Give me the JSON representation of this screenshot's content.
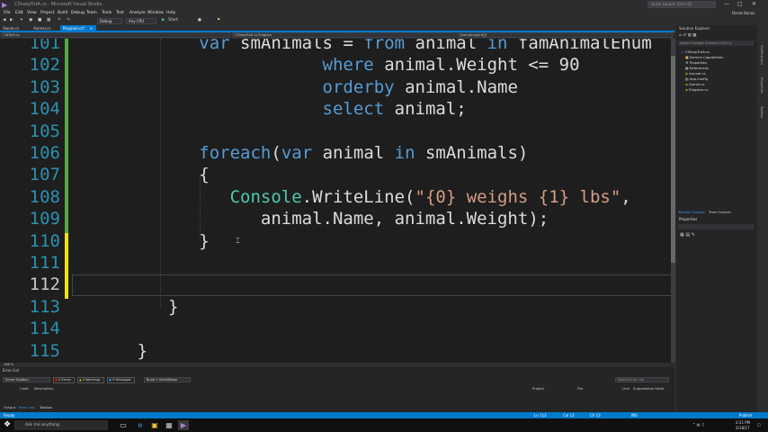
{
  "window": {
    "title": "CSharpTutA.cs - Microsoft Visual Studio",
    "quick_launch_placeholder": "Quick Launch (Ctrl+Q)",
    "user": "Derek Banas"
  },
  "menu": [
    "File",
    "Edit",
    "View",
    "Project",
    "Build",
    "Debug",
    "Team",
    "Tools",
    "Test",
    "Analyze",
    "Window",
    "Help"
  ],
  "toolbar": {
    "config": "Debug",
    "platform": "Any CPU",
    "start_label": "Start"
  },
  "doc_tabs": [
    {
      "label": "Owner.cs",
      "active": false
    },
    {
      "label": "Animal.cs",
      "active": false
    },
    {
      "label": "Program.cs*",
      "active": true
    }
  ],
  "nav": {
    "project": "C#Tut5.cs",
    "class": "CSharpTutA.cs.Program",
    "member": "QueryArray(int[])"
  },
  "editor": {
    "lines": [
      {
        "num": "101",
        "current": false,
        "changed": "green",
        "parts": [
          [
            "pl",
            "            "
          ],
          [
            "kw",
            "var"
          ],
          [
            "pl",
            " smAnimals = "
          ],
          [
            "kw",
            "from"
          ],
          [
            "pl",
            " animal "
          ],
          [
            "kw",
            "in"
          ],
          [
            "pl",
            " famAnimalEnum"
          ]
        ]
      },
      {
        "num": "102",
        "current": false,
        "changed": "green",
        "parts": [
          [
            "pl",
            "                        "
          ],
          [
            "kw",
            "where"
          ],
          [
            "pl",
            " animal.Weight <= 90"
          ]
        ]
      },
      {
        "num": "103",
        "current": false,
        "changed": "green",
        "parts": [
          [
            "pl",
            "                        "
          ],
          [
            "kw",
            "orderby"
          ],
          [
            "pl",
            " animal.Name"
          ]
        ]
      },
      {
        "num": "104",
        "current": false,
        "changed": "green",
        "parts": [
          [
            "pl",
            "                        "
          ],
          [
            "kw",
            "select"
          ],
          [
            "pl",
            " animal;"
          ]
        ]
      },
      {
        "num": "105",
        "current": false,
        "changed": "green",
        "parts": [
          [
            "pl",
            ""
          ]
        ]
      },
      {
        "num": "106",
        "current": false,
        "changed": "green",
        "parts": [
          [
            "pl",
            "            "
          ],
          [
            "kw",
            "foreach"
          ],
          [
            "pl",
            "("
          ],
          [
            "kw",
            "var"
          ],
          [
            "pl",
            " animal "
          ],
          [
            "kw",
            "in"
          ],
          [
            "pl",
            " smAnimals)"
          ]
        ]
      },
      {
        "num": "107",
        "current": false,
        "changed": "green",
        "parts": [
          [
            "pl",
            "            {"
          ]
        ]
      },
      {
        "num": "108",
        "current": false,
        "changed": "green",
        "parts": [
          [
            "pl",
            "               "
          ],
          [
            "ty",
            "Console"
          ],
          [
            "pl",
            ".WriteLine("
          ],
          [
            "st",
            "\"{0} weighs {1} lbs\""
          ],
          [
            "pl",
            ","
          ]
        ]
      },
      {
        "num": "109",
        "current": false,
        "changed": "green",
        "parts": [
          [
            "pl",
            "                  animal.Name, animal.Weight);"
          ]
        ]
      },
      {
        "num": "110",
        "current": false,
        "changed": "yellow",
        "parts": [
          [
            "pl",
            "            }"
          ]
        ]
      },
      {
        "num": "111",
        "current": false,
        "changed": "yellow",
        "parts": [
          [
            "pl",
            ""
          ]
        ]
      },
      {
        "num": "112",
        "current": true,
        "changed": "yellow",
        "parts": [
          [
            "pl",
            ""
          ]
        ]
      },
      {
        "num": "113",
        "current": false,
        "changed": "none",
        "parts": [
          [
            "pl",
            "         }"
          ]
        ]
      },
      {
        "num": "114",
        "current": false,
        "changed": "none",
        "parts": [
          [
            "pl",
            ""
          ]
        ]
      },
      {
        "num": "115",
        "current": false,
        "changed": "none",
        "parts": [
          [
            "pl",
            "      }"
          ]
        ]
      }
    ],
    "zoom": "166 %"
  },
  "solution_explorer": {
    "title": "Solution Explorer",
    "search_placeholder": "Search Solution Explorer (Ctrl+;)",
    "items": [
      {
        "label": "CSharpTutA.cs",
        "indent": 1,
        "icon": "project-icon"
      },
      {
        "label": "Service Capabilities",
        "indent": 2,
        "icon": "folder-icon"
      },
      {
        "label": "Properties",
        "indent": 2,
        "icon": "wrench-icon"
      },
      {
        "label": "References",
        "indent": 2,
        "icon": "references-icon"
      },
      {
        "label": "Animal.cs",
        "indent": 2,
        "icon": "csharp-file-icon"
      },
      {
        "label": "App.config",
        "indent": 2,
        "icon": "config-file-icon"
      },
      {
        "label": "Owner.cs",
        "indent": 2,
        "icon": "csharp-file-icon"
      },
      {
        "label": "Program.cs",
        "indent": 2,
        "icon": "csharp-file-icon"
      }
    ],
    "tabs": [
      "Solution Explorer",
      "Team Explorer"
    ]
  },
  "right_strip": [
    "Notifications",
    "Properties",
    "Toolbox"
  ],
  "properties": {
    "title": "Properties"
  },
  "error_list": {
    "title": "Error List",
    "scope": "Entire Solution",
    "errors": "0 Errors",
    "warnings": "0 Warnings",
    "messages": "0 Messages",
    "build_filter": "Build + IntelliSense",
    "search_placeholder": "Search Error List",
    "columns": [
      "Code",
      "Description",
      "Project",
      "File",
      "Line",
      "Suppression State"
    ],
    "tabs": [
      "Output",
      "Error List",
      "Toolbox"
    ]
  },
  "status": {
    "state": "Ready",
    "ln": "Ln 112",
    "col": "Col 13",
    "ch": "Ch 13",
    "mode": "INS",
    "publish": "Publish"
  },
  "taskbar": {
    "search_placeholder": "Ask me anything",
    "time": "2:21 PM",
    "date": "2/18/17"
  },
  "colors": {
    "accent": "#007acc",
    "keyword": "#569cd6",
    "type": "#4ec9b0",
    "string": "#d69d85",
    "line_number": "#2b91af",
    "changed_saved": "#57a64a",
    "changed_unsaved": "#efe10b"
  }
}
